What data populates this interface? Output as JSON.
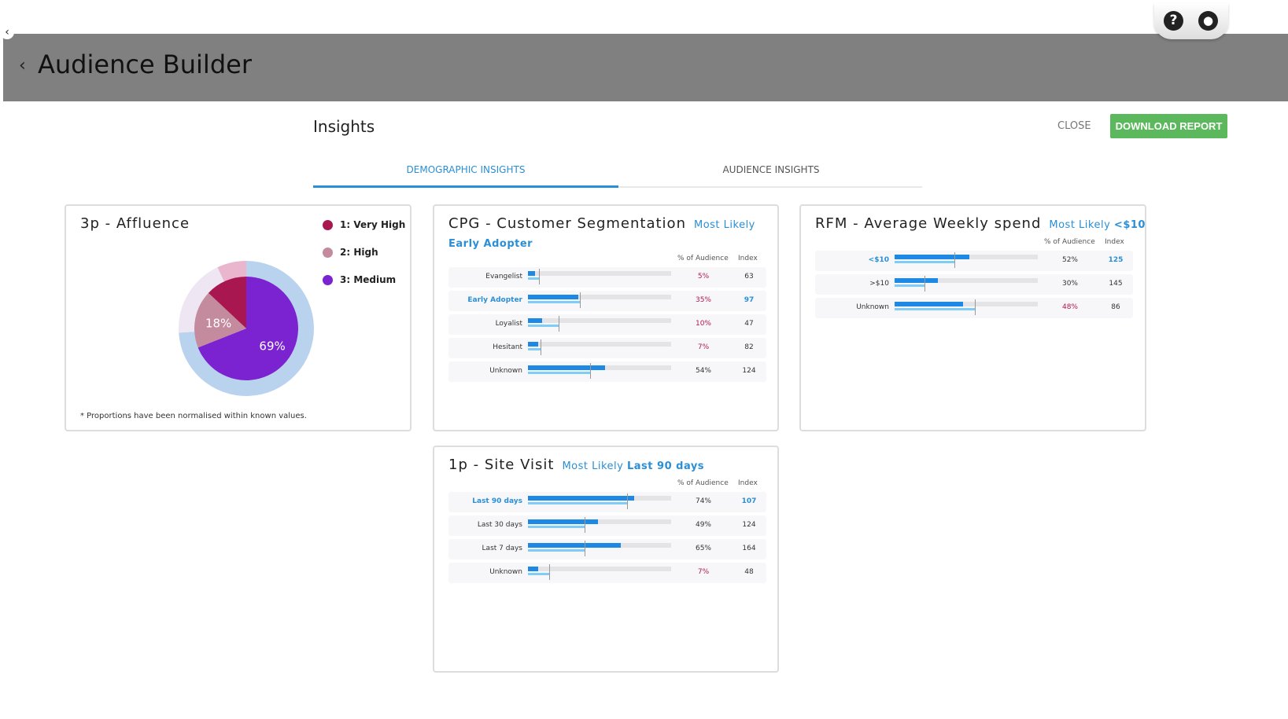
{
  "app": {
    "title": "Audience Builder",
    "help_icon": "question-circle-icon",
    "user_icon": "user-circle-icon"
  },
  "panel": {
    "title": "Insights",
    "close_label": "CLOSE",
    "download_label": "DOWNLOAD REPORT"
  },
  "tabs": [
    {
      "label": "DEMOGRAPHIC INSIGHTS",
      "active": true
    },
    {
      "label": "AUDIENCE INSIGHTS",
      "active": false
    }
  ],
  "colors": {
    "accent": "#2a8fd6",
    "download": "#5cb85c",
    "bar": "#1e88e5",
    "baseline": "#7fcdf7",
    "low_pct": "#b0174f"
  },
  "affluence": {
    "title": "3p - Affluence",
    "note": "* Proportions have been normalised within known values.",
    "chart_data": {
      "type": "pie",
      "series": [
        {
          "name": "1: Very High",
          "value": 13,
          "color": "#a8174f"
        },
        {
          "name": "2: High",
          "value": 18,
          "color": "#c48a9e",
          "label": "18%"
        },
        {
          "name": "3: Medium",
          "value": 69,
          "color": "#7b22d1",
          "label": "69%"
        }
      ],
      "outer_ring": [
        {
          "value": 74,
          "color": "#b9d3ee"
        },
        {
          "value": 19,
          "color": "#efe6f3"
        },
        {
          "value": 7,
          "color": "#e9b6cd"
        }
      ]
    }
  },
  "headers": {
    "pct": "% of Audience",
    "index": "Index"
  },
  "cpg": {
    "title": "CPG - Customer Segmentation",
    "most_likely": "Most Likely",
    "most_likely_value": "Early Adopter",
    "rows": [
      {
        "label": "Evangelist",
        "pct": 5,
        "pct_label": "5%",
        "index": "63",
        "low": true
      },
      {
        "label": "Early Adopter",
        "pct": 35,
        "pct_label": "35%",
        "index": "97",
        "low": true,
        "highlight": true
      },
      {
        "label": "Loyalist",
        "pct": 10,
        "pct_label": "10%",
        "index": "47",
        "low": true
      },
      {
        "label": "Hesitant",
        "pct": 7,
        "pct_label": "7%",
        "index": "82",
        "low": true
      },
      {
        "label": "Unknown",
        "pct": 54,
        "pct_label": "54%",
        "index": "124"
      }
    ]
  },
  "rfm": {
    "title": "RFM - Average Weekly spend",
    "most_likely": "Most Likely",
    "most_likely_value": "<$10",
    "rows": [
      {
        "label": "<$10",
        "pct": 52,
        "pct_label": "52%",
        "index": "125",
        "highlight": true
      },
      {
        "label": ">$10",
        "pct": 30,
        "pct_label": "30%",
        "index": "145"
      },
      {
        "label": "Unknown",
        "pct": 48,
        "pct_label": "48%",
        "index": "86",
        "low": true
      }
    ]
  },
  "site": {
    "title": "1p - Site Visit",
    "most_likely": "Most Likely",
    "most_likely_value": "Last 90 days",
    "rows": [
      {
        "label": "Last 90 days",
        "pct": 74,
        "pct_label": "74%",
        "index": "107",
        "highlight": true
      },
      {
        "label": "Last 30 days",
        "pct": 49,
        "pct_label": "49%",
        "index": "124"
      },
      {
        "label": "Last 7 days",
        "pct": 65,
        "pct_label": "65%",
        "index": "164"
      },
      {
        "label": "Unknown",
        "pct": 7,
        "pct_label": "7%",
        "index": "48",
        "low": true
      }
    ]
  }
}
